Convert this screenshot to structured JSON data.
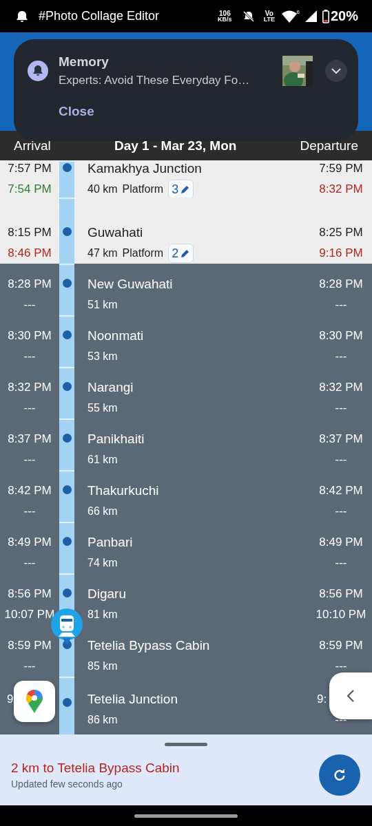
{
  "status_bar": {
    "app_title": "#Photo Collage Editor",
    "speed_value": "106",
    "speed_unit": "KB/s",
    "volte_top": "Vo",
    "volte_bottom": "LTE",
    "wifi_badge": "6",
    "battery": "20%"
  },
  "notification": {
    "app": "Memory",
    "text": "Experts: Avoid These Everyday Fo…",
    "action": "Close"
  },
  "header": {
    "arrival": "Arrival",
    "day": "Day 1 - Mar 23, Mon",
    "departure": "Departure"
  },
  "stops": [
    {
      "name": "Kamakhya Junction",
      "distance": "40 km",
      "platform_label": "Platform",
      "platform": "3",
      "sched_arrival": "7:57 PM",
      "actual_arrival": "7:54 PM",
      "arrival_late": false,
      "sched_departure": "7:59 PM",
      "actual_departure": "8:32 PM",
      "departure_late": true,
      "passed": true,
      "train_here": false,
      "partial": false
    },
    {
      "name": "Guwahati",
      "distance": "47 km",
      "platform_label": "Platform",
      "platform": "2",
      "sched_arrival": "8:15 PM",
      "actual_arrival": "8:46 PM",
      "arrival_late": true,
      "sched_departure": "8:25 PM",
      "actual_departure": "9:16 PM",
      "departure_late": true,
      "passed": true,
      "train_here": false,
      "partial": false
    },
    {
      "name": "New Guwahati",
      "distance": "51 km",
      "sched_arrival": "8:28 PM",
      "actual_arrival": "---",
      "sched_departure": "8:28 PM",
      "actual_departure": "---",
      "passed": false,
      "train_here": false,
      "partial": false
    },
    {
      "name": "Noonmati",
      "distance": "53 km",
      "sched_arrival": "8:30 PM",
      "actual_arrival": "---",
      "sched_departure": "8:30 PM",
      "actual_departure": "---",
      "passed": false,
      "train_here": false,
      "partial": false
    },
    {
      "name": "Narangi",
      "distance": "55 km",
      "sched_arrival": "8:32 PM",
      "actual_arrival": "---",
      "sched_departure": "8:32 PM",
      "actual_departure": "---",
      "passed": false,
      "train_here": false,
      "partial": false
    },
    {
      "name": "Panikhaiti",
      "distance": "61 km",
      "sched_arrival": "8:37 PM",
      "actual_arrival": "---",
      "sched_departure": "8:37 PM",
      "actual_departure": "---",
      "passed": false,
      "train_here": false,
      "partial": false
    },
    {
      "name": "Thakurkuchi",
      "distance": "66 km",
      "sched_arrival": "8:42 PM",
      "actual_arrival": "---",
      "sched_departure": "8:42 PM",
      "actual_departure": "---",
      "passed": false,
      "train_here": false,
      "partial": false
    },
    {
      "name": "Panbari",
      "distance": "74 km",
      "sched_arrival": "8:49 PM",
      "actual_arrival": "---",
      "sched_departure": "8:49 PM",
      "actual_departure": "---",
      "passed": false,
      "train_here": false,
      "partial": false
    },
    {
      "name": "Digaru",
      "distance": "81 km",
      "sched_arrival": "8:56 PM",
      "actual_arrival": "10:07 PM",
      "sched_departure": "8:56 PM",
      "actual_departure": "10:10 PM",
      "passed": false,
      "train_here": false,
      "partial": false
    },
    {
      "name": "Tetelia Bypass Cabin",
      "distance": "85 km",
      "sched_arrival": "8:59 PM",
      "actual_arrival": "---",
      "sched_departure": "8:59 PM",
      "actual_departure": "---",
      "passed": false,
      "train_here": true,
      "partial": false
    },
    {
      "name": "Tetelia Junction",
      "distance": "86 km",
      "sched_arrival": "9",
      "sched_departure": "9:",
      "actual_departure": "---",
      "passed": false,
      "train_here": false,
      "partial": true
    }
  ],
  "bottom_sheet": {
    "title": "2 km to Tetelia Bypass Cabin",
    "subtitle": "Updated few seconds ago"
  }
}
